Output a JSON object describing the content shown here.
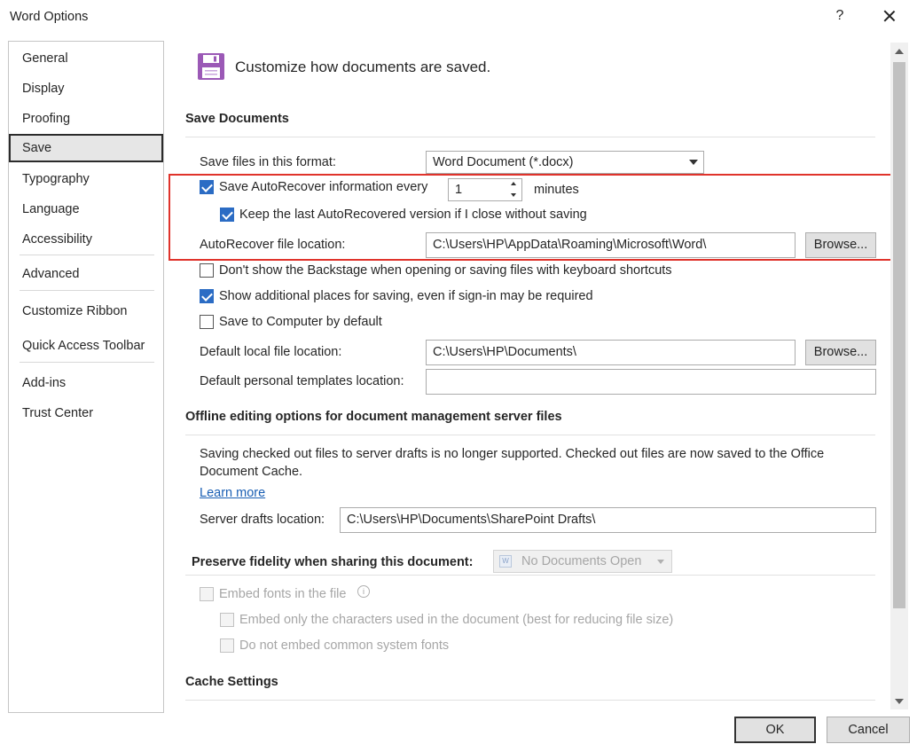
{
  "window": {
    "title": "Word Options",
    "help": "?"
  },
  "nav": {
    "items": [
      {
        "label": "General"
      },
      {
        "label": "Display"
      },
      {
        "label": "Proofing"
      },
      {
        "label": "Save"
      },
      {
        "label": "Typography"
      },
      {
        "label": "Language"
      },
      {
        "label": "Accessibility"
      },
      {
        "label": "Advanced"
      },
      {
        "label": "Customize Ribbon"
      },
      {
        "label": "Quick Access Toolbar"
      },
      {
        "label": "Add-ins"
      },
      {
        "label": "Trust Center"
      }
    ],
    "selected": "Save"
  },
  "header": {
    "text": "Customize how documents are saved.",
    "icon": "save-floppy-icon",
    "icon_color": "#9b59b6"
  },
  "save_documents": {
    "title": "Save Documents",
    "format_label": "Save files in this format:",
    "format_value": "Word Document (*.docx)",
    "autorecover_label": "Save AutoRecover information every",
    "autorecover_checked": true,
    "autorecover_minutes": "1",
    "minutes_label": "minutes",
    "keep_last_label": "Keep the last AutoRecovered version if I close without saving",
    "keep_last_checked": true,
    "autorecover_location_label": "AutoRecover file location:",
    "autorecover_location_value": "C:\\Users\\HP\\AppData\\Roaming\\Microsoft\\Word\\",
    "browse_label": "Browse...",
    "dont_show_backstage_label": "Don't show the Backstage when opening or saving files with keyboard shortcuts",
    "dont_show_backstage_checked": false,
    "show_additional_label": "Show additional places for saving, even if sign-in may be required",
    "show_additional_checked": true,
    "save_to_computer_label": "Save to Computer by default",
    "save_to_computer_checked": false,
    "default_local_label": "Default local file location:",
    "default_local_value": "C:\\Users\\HP\\Documents\\",
    "browse2_label": "Browse...",
    "default_templates_label": "Default personal templates location:",
    "default_templates_value": ""
  },
  "offline": {
    "title": "Offline editing options for document management server files",
    "description_line1": "Saving checked out files to server drafts is no longer supported. Checked out files are now saved to the Office",
    "description_line2": "Document Cache.",
    "learn_more": "Learn more",
    "server_drafts_label": "Server drafts location:",
    "server_drafts_value": "C:\\Users\\HP\\Documents\\SharePoint Drafts\\"
  },
  "fidelity": {
    "title": "Preserve fidelity when sharing this document:",
    "document_select": "No Documents Open",
    "embed_fonts_label": "Embed fonts in the file",
    "embed_fonts_info": "i",
    "embed_only_used_label": "Embed only the characters used in the document (best for reducing file size)",
    "no_common_fonts_label": "Do not embed common system fonts"
  },
  "cache": {
    "title": "Cache Settings"
  },
  "footer": {
    "ok_label": "OK",
    "cancel_label": "Cancel"
  },
  "highlight_color": "#e0332b",
  "accent_color": "#2b6cc4"
}
